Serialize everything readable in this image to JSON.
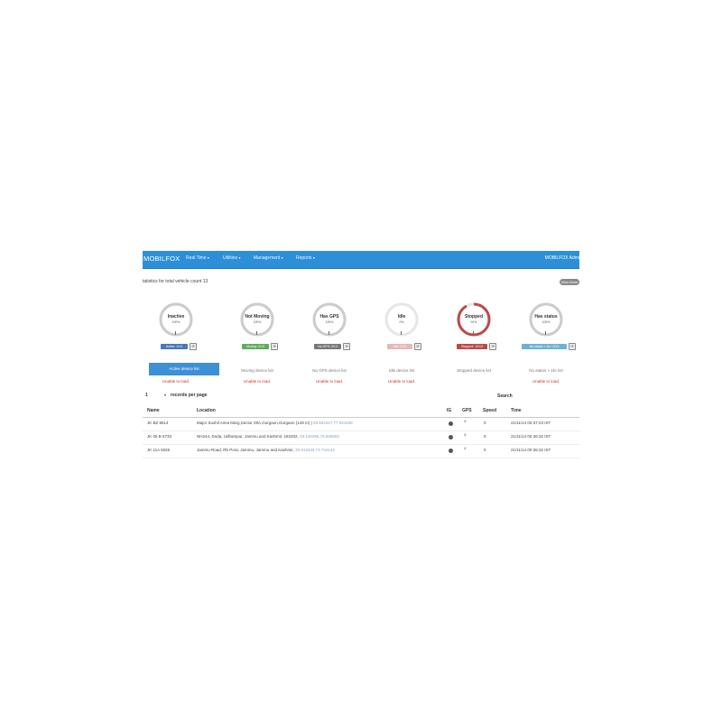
{
  "navbar": {
    "brand": "MOBILFOX",
    "menu": [
      {
        "label": "Real Time"
      },
      {
        "label": "Utilities"
      },
      {
        "label": "Management"
      },
      {
        "label": "Reports"
      }
    ],
    "user": "MOBILFOX Admi"
  },
  "stats": {
    "caption": "tatistics for total vehicle count 13",
    "view_button": "View More"
  },
  "cards": [
    {
      "title": "Inactive",
      "pct": "100%",
      "fill": 1.0,
      "color": "#cccccc",
      "badge": "Active: 1/13",
      "badge_color": "#4a78b8",
      "link": "Active device list",
      "unable": "Unable to load."
    },
    {
      "title": "Not Moving",
      "pct": "100%",
      "fill": 1.0,
      "color": "#cccccc",
      "badge": "Moving: 0/13",
      "badge_color": "#5cae5c",
      "link": "Moving device list",
      "unable": "Unable to load."
    },
    {
      "title": "Has GPS",
      "pct": "100%",
      "fill": 1.0,
      "color": "#cccccc",
      "badge": "No GPS: 0/13",
      "badge_color": "#777777",
      "link": "No GPS device list",
      "unable": "Unable to load."
    },
    {
      "title": "Idle",
      "pct": "0%",
      "fill": 0.0,
      "color": "#cccccc",
      "badge": "Idle: 0/13",
      "badge_color": "#e6b8b8",
      "link": "Idle device list",
      "unable": "Unable to load."
    },
    {
      "title": "Stopped",
      "pct": "92%",
      "fill": 0.92,
      "color": "#b94a48",
      "badge": "Stopped: 12/13",
      "badge_color": "#b94a48",
      "link": "Stopped device list",
      "unable": ""
    },
    {
      "title": "Has status",
      "pct": "100%",
      "fill": 1.0,
      "color": "#cccccc",
      "badge": "No status > 1hr: 0/13",
      "badge_color": "#6cb2d6",
      "link": "No status > 1hr list",
      "unable": "Unable to load."
    }
  ],
  "table": {
    "records_value": "1",
    "records_label": "records per page",
    "search_label": "Search",
    "headers": [
      "Name",
      "Location",
      "IG",
      "GPS",
      "Speed",
      "Time"
    ],
    "rows": [
      {
        "name": "JK BZ 9614",
        "location": "Major Sushil Aima Marg,Sector 29A,Gurgaon,Gurgaon (149 m)",
        "coords": "28.504417,77.041839",
        "speed": "0",
        "time": "21/11/14 00:37:23 IST"
      },
      {
        "name": "JK 05 B 6733",
        "location": "NH244, Doda, Udhampur, Jammu and Kashmir, 182202,",
        "coords": "33.140455,75.545602",
        "speed": "0",
        "time": "21/11/14 00:36:32 IST"
      },
      {
        "name": "JK 11A 5025",
        "location": "Jammu Road, Rb Pora, Jammu, Jammu and Kashmir,",
        "coords": "32.613442,74.744142",
        "speed": "0",
        "time": "21/11/14 00:36:32 IST"
      }
    ]
  }
}
